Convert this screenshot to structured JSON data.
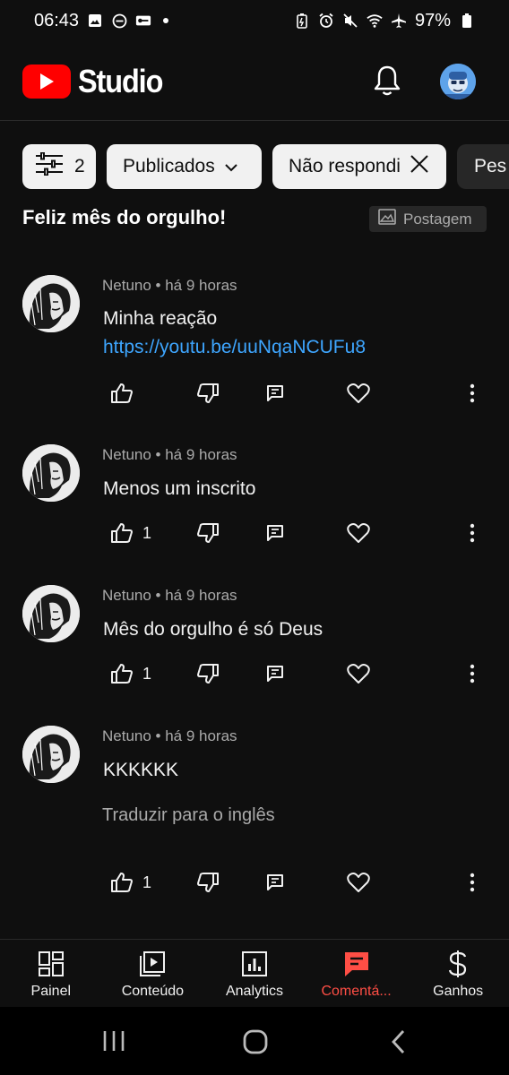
{
  "status_bar": {
    "time": "06:43",
    "battery": "97%"
  },
  "header": {
    "logo_text": "Studio",
    "brand_color": "#ff0000"
  },
  "filters": {
    "filter_count": "2",
    "chips": [
      {
        "label": "Publicados"
      },
      {
        "label": "Não respondi"
      },
      {
        "label": "Pes"
      }
    ]
  },
  "post": {
    "title": "Feliz mês do orgulho!",
    "badge": "Postagem"
  },
  "comments": [
    {
      "author_meta": "Netuno • há 9 horas",
      "text": "Minha reação",
      "link": "https://youtu.be/uuNqaNCUFu8",
      "likes": ""
    },
    {
      "author_meta": "Netuno • há 9 horas",
      "text": "Menos um inscrito",
      "likes": "1"
    },
    {
      "author_meta": "Netuno • há 9 horas",
      "text": "Mês do orgulho é só Deus",
      "likes": "1"
    },
    {
      "author_meta": "Netuno • há 9 horas",
      "text": "KKKKKK",
      "translate": "Traduzir para o inglês",
      "likes": "1"
    }
  ],
  "bottom_nav": [
    {
      "label": "Painel",
      "icon": "dashboard-icon"
    },
    {
      "label": "Conteúdo",
      "icon": "content-icon"
    },
    {
      "label": "Analytics",
      "icon": "analytics-icon"
    },
    {
      "label": "Comentá...",
      "icon": "comments-icon",
      "active": true
    },
    {
      "label": "Ganhos",
      "icon": "earn-icon"
    }
  ],
  "colors": {
    "accent_active": "#ff4e45",
    "link": "#3ea6ff"
  }
}
